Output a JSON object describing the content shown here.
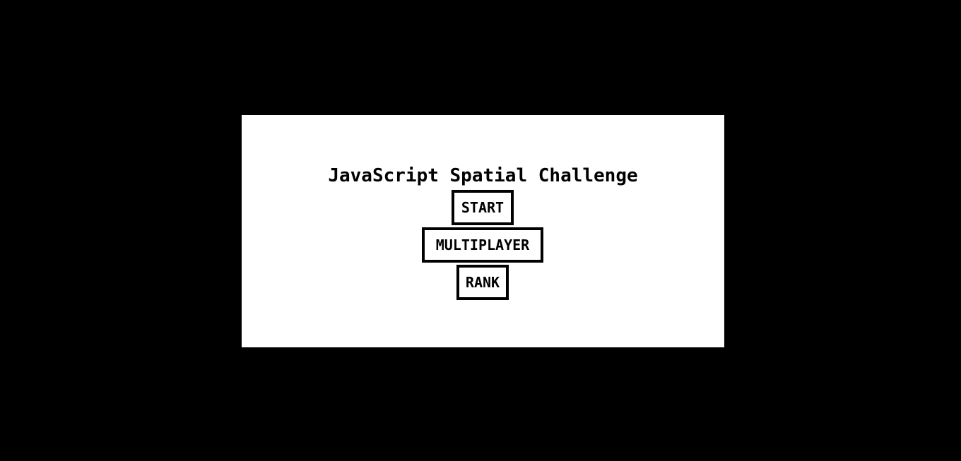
{
  "colors": {
    "page_background": "#000000",
    "canvas_background": "#ffffff",
    "text": "#000000",
    "button_border": "#000000"
  },
  "menu": {
    "title": "JavaScript Spatial Challenge",
    "buttons": {
      "start": "START",
      "multiplayer": "MULTIPLAYER",
      "rank": "RANK"
    }
  }
}
